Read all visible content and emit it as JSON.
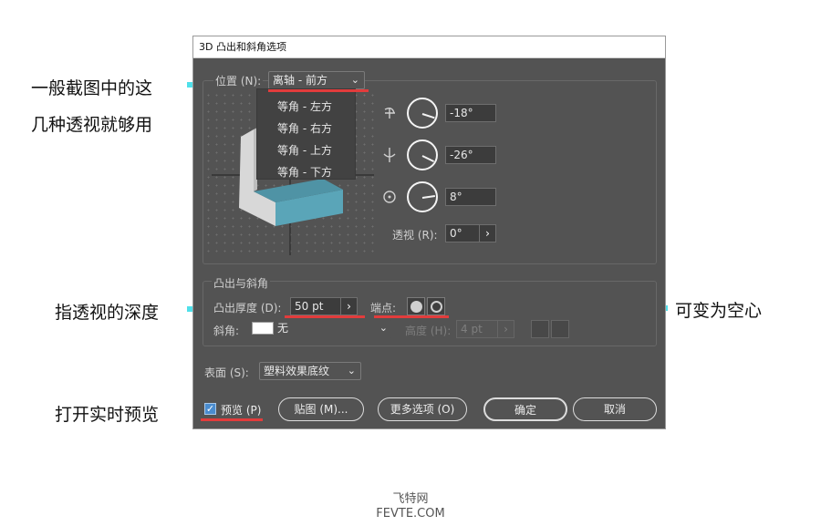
{
  "annotations": {
    "left_1_line1": "一般截图中的这",
    "left_1_line2": "几种透视就够用",
    "left_2": "指透视的深度",
    "left_3": "打开实时预览",
    "right_1": "可变为空心"
  },
  "dialog": {
    "title": "3D 凸出和斜角选项",
    "position": {
      "label": "位置 (N):",
      "selected": "离轴 - 前方",
      "options": [
        "等角 - 左方",
        "等角 - 右方",
        "等角 - 上方",
        "等角 - 下方"
      ]
    },
    "rotation": {
      "x_value": "-18°",
      "y_value": "-26°",
      "z_value": "8°",
      "x_angle": -18,
      "y_angle": -26,
      "z_angle": 8
    },
    "perspective": {
      "label": "透视 (R):",
      "value": "0°"
    },
    "extrude": {
      "group_label": "凸出与斜角",
      "depth_label": "凸出厚度 (D):",
      "depth_value": "50 pt",
      "cap_label": "端点:",
      "bevel_label": "斜角:",
      "bevel_value": "无",
      "height_label": "高度 (H):",
      "height_value": "4 pt"
    },
    "surface": {
      "label": "表面 (S):",
      "value": "塑料效果底纹"
    },
    "buttons": {
      "preview_label": "预览 (P)",
      "map_art": "贴图 (M)...",
      "more_options": "更多选项 (O)",
      "ok": "确定",
      "cancel": "取消"
    }
  },
  "watermark": {
    "line1": "飞特网",
    "line2": "FEVTE.COM"
  },
  "colors": {
    "arrow": "#4fe0ea",
    "highlight": "#e23c3c",
    "dialog_bg": "#535353",
    "cube_front": "#5aa5b8",
    "checkbox": "#4a8ccf"
  }
}
